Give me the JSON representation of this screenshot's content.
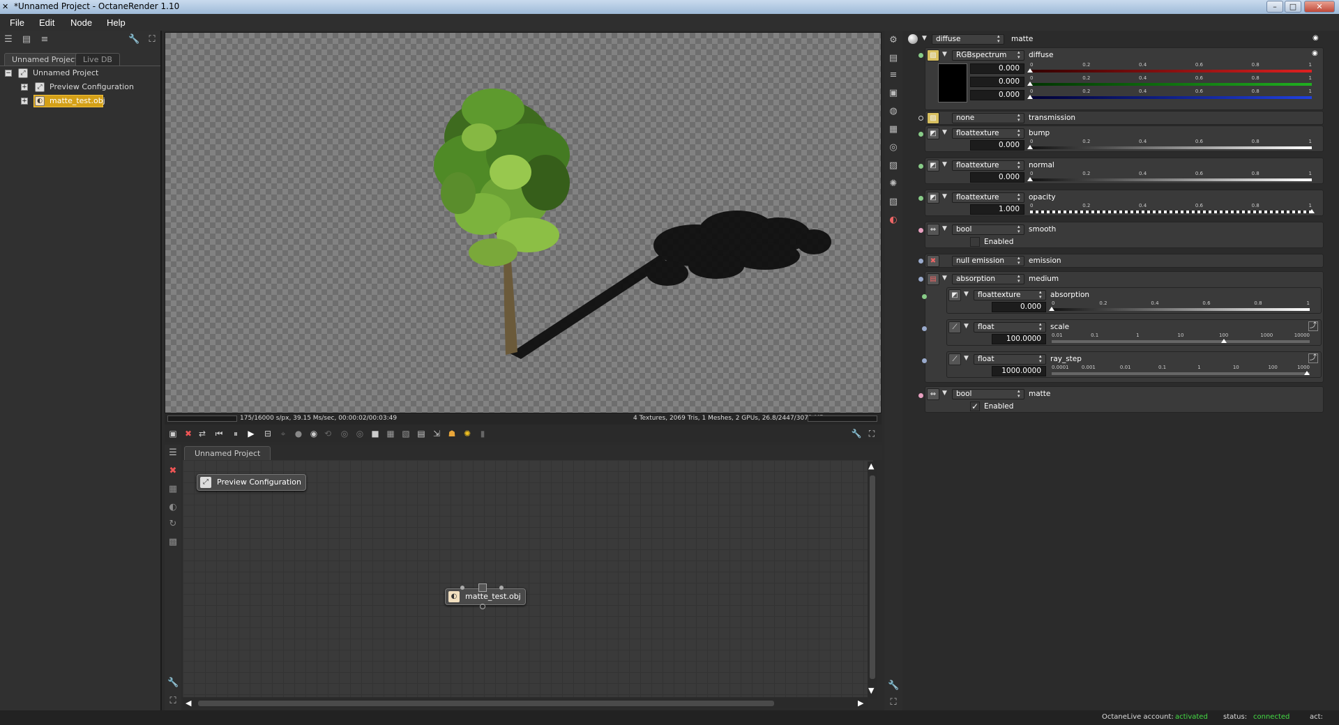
{
  "window": {
    "title": "*Unnamed Project - OctaneRender 1.10",
    "minimize": "–",
    "maximize": "□",
    "close": "✕"
  },
  "menu": [
    "File",
    "Edit",
    "Node",
    "Help"
  ],
  "left": {
    "tabs": [
      "Unnamed Project",
      "Live DB"
    ],
    "tree": [
      {
        "label": "Unnamed Project",
        "expander": "−"
      },
      {
        "label": "Preview Configuration",
        "expander": "+"
      },
      {
        "label": "matte_test.obj",
        "expander": "+",
        "selected": true
      }
    ]
  },
  "viewport": {
    "status_left": "175/16000 s/px, 39.15 Ms/sec, 00:00:02/00:03:49",
    "status_right": "4 Textures, 2069 Tris, 1 Meshes, 2 GPUs, 26.8/2447/3072 MB"
  },
  "nodegraph": {
    "tab": "Unnamed Project",
    "nodes": [
      "Preview Configuration",
      "matte_test.obj"
    ]
  },
  "inspector": {
    "header": {
      "type": "diffuse",
      "name": "matte"
    },
    "diffuse": {
      "type": "RGBspectrum",
      "label": "diffuse",
      "r": "0.000",
      "g": "0.000",
      "b": "0.000"
    },
    "transmission": {
      "type": "none",
      "label": "transmission"
    },
    "bump": {
      "type": "floattexture",
      "label": "bump",
      "value": "0.000"
    },
    "normal": {
      "type": "floattexture",
      "label": "normal",
      "value": "0.000"
    },
    "opacity": {
      "type": "floattexture",
      "label": "opacity",
      "value": "1.000"
    },
    "smooth": {
      "type": "bool",
      "label": "smooth",
      "check_label": "Enabled",
      "checked": false
    },
    "emission": {
      "type": "null emission",
      "label": "emission"
    },
    "medium": {
      "type": "absorption",
      "label": "medium",
      "absorption": {
        "type": "floattexture",
        "label": "absorption",
        "value": "0.000"
      },
      "scale": {
        "type": "float",
        "label": "scale",
        "value": "100.0000"
      },
      "ray_step": {
        "type": "float",
        "label": "ray_step",
        "value": "1000.0000"
      }
    },
    "matte": {
      "type": "bool",
      "label": "matte",
      "check_label": "Enabled",
      "checked": true
    },
    "ticks01": [
      "0",
      "0.2",
      "0.4",
      "0.6",
      "0.8",
      "1"
    ],
    "ticks_scale": [
      "0.01",
      "0.1",
      "1",
      "10",
      "100",
      "1000",
      "10000"
    ],
    "ticks_ray": [
      "0.0001",
      "0.001",
      "0.01",
      "0.1",
      "1",
      "10",
      "100",
      "1000"
    ]
  },
  "statusbar": {
    "account_label": "OctaneLive account:",
    "account_value": "activated",
    "status_label": "status:",
    "status_value": "connected",
    "act_label": "act:"
  },
  "colors": {
    "accent_green": "#44dd44",
    "selection": "#d4a017"
  }
}
